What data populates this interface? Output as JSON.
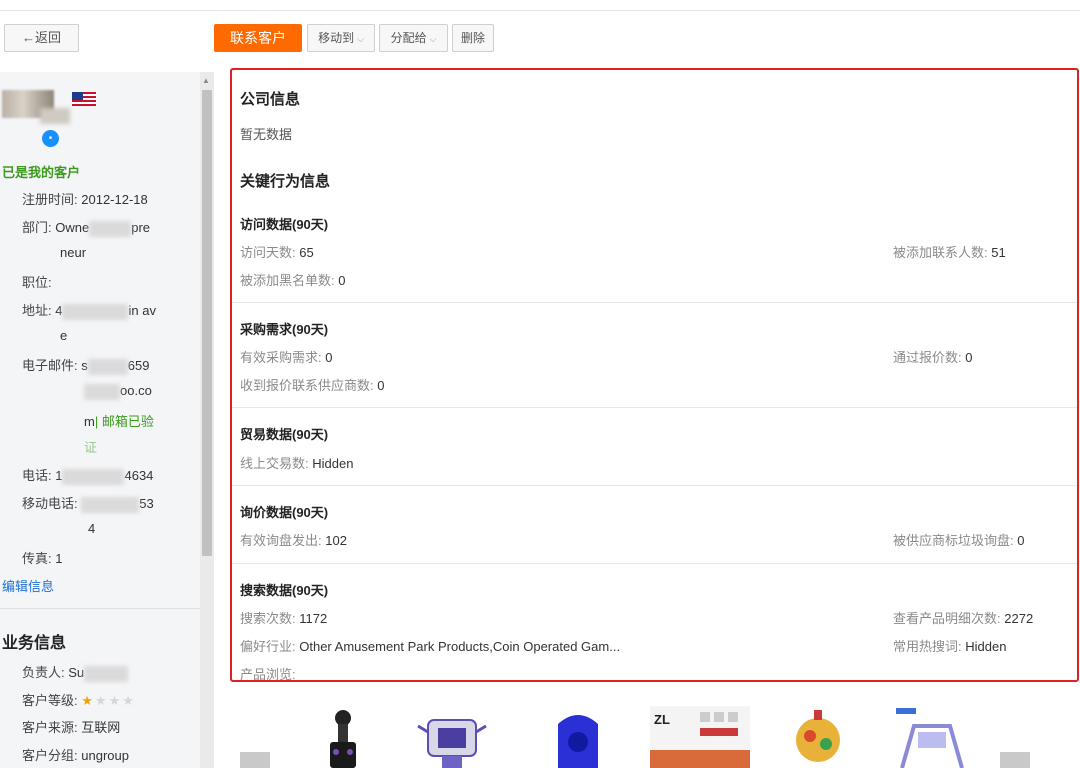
{
  "toolbar": {
    "back_label": "←返回",
    "contact_label": "联系客户",
    "move_label": "移动到",
    "assign_label": "分配给",
    "delete_label": "删除",
    "accent": "#ff6a00"
  },
  "profile": {
    "status": "已是我的客户",
    "badge": "•",
    "fields": {
      "register_label": "注册时间:",
      "register_value": "2012-12-18",
      "dept_label": "部门:",
      "dept_value_a": "Owne",
      "dept_value_b": "pre",
      "dept_value_c": "neur",
      "position_label": "职位:",
      "address_label": "地址:",
      "address_value_a": "4",
      "address_value_b": "in av",
      "address_value_c": "e",
      "email_label": "电子邮件:",
      "email_value_a": "s",
      "email_value_b": "659",
      "email_value_c": "oo.co",
      "email_value_d": "m",
      "email_verified": "| 邮箱已验",
      "email_verified_b": "证",
      "phone_label": "电话:",
      "phone_value_a": "1",
      "phone_value_b": "4634",
      "mobile_label": "移动电话:",
      "mobile_value_a": "53",
      "mobile_value_b": "4",
      "fax_label": "传真:",
      "fax_value": "1"
    },
    "edit_link": "编辑信息"
  },
  "business": {
    "title": "业务信息",
    "owner_label": "负责人:",
    "owner_value": "Su",
    "level_label": "客户等级:",
    "level_stars": 1,
    "level_max": 4,
    "source_label": "客户来源:",
    "source_value": "互联网",
    "group_label": "客户分组:",
    "group_value": "ungroup"
  },
  "company": {
    "title": "公司信息",
    "empty": "暂无数据"
  },
  "behavior": {
    "title": "关键行为信息",
    "visit": {
      "title": "访问数据(90天)",
      "days_label": "访问天数:",
      "days_value": "65",
      "added_label": "被添加联系人数:",
      "added_value": "51",
      "blacklist_label": "被添加黑名单数:",
      "blacklist_value": "0"
    },
    "purchase": {
      "title": "采购需求(90天)",
      "valid_label": "有效采购需求:",
      "valid_value": "0",
      "quote_label": "通过报价数:",
      "quote_value": "0",
      "supplier_label": "收到报价联系供应商数:",
      "supplier_value": "0"
    },
    "trade": {
      "title": "贸易数据(90天)",
      "online_label": "线上交易数:",
      "online_value": "Hidden"
    },
    "inquiry": {
      "title": "询价数据(90天)",
      "sent_label": "有效询盘发出:",
      "sent_value": "102",
      "spam_label": "被供应商标垃圾询盘:",
      "spam_value": "0"
    },
    "search": {
      "title": "搜索数据(90天)",
      "count_label": "搜索次数:",
      "count_value": "1172",
      "detail_label": "查看产品明细次数:",
      "detail_value": "2272",
      "industry_label": "偏好行业:",
      "industry_value": "Other Amusement Park Products,Coin Operated Gam...",
      "keywords_label": "常用热搜词:",
      "keywords_value": "Hidden",
      "browse_label": "产品浏览:"
    }
  }
}
